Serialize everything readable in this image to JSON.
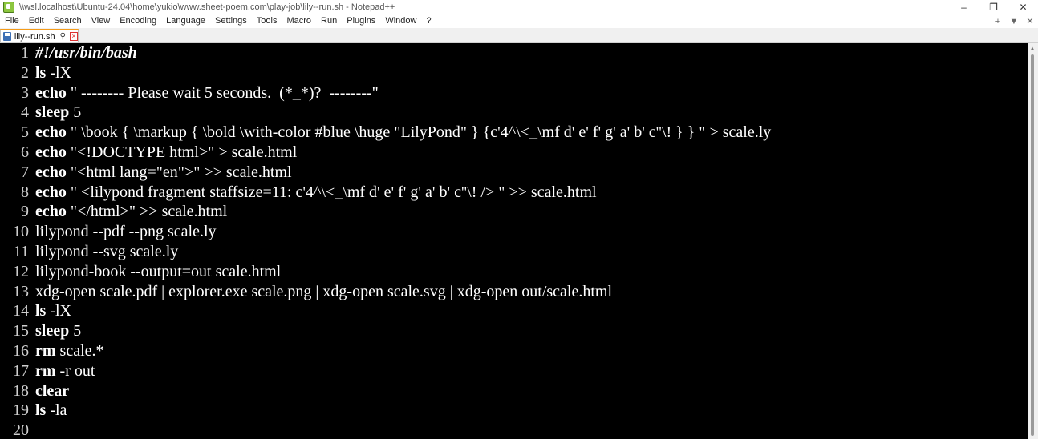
{
  "window": {
    "title": "\\\\wsl.localhost\\Ubuntu-24.04\\home\\yukio\\www.sheet-poem.com\\play-job\\lily--run.sh - Notepad++",
    "minimize": "–",
    "restore": "❐",
    "close": "✕"
  },
  "menu": {
    "items": [
      "File",
      "Edit",
      "Search",
      "View",
      "Encoding",
      "Language",
      "Settings",
      "Tools",
      "Macro",
      "Run",
      "Plugins",
      "Window",
      "?"
    ],
    "right": [
      "+",
      "▼",
      "✕"
    ]
  },
  "tab": {
    "label": "lily--run.sh",
    "pin": "📌",
    "close": "×"
  },
  "editor": {
    "lines": [
      {
        "n": "1",
        "kw": "#!/usr/bin/bash",
        "kwStyle": "shebang",
        "rest": ""
      },
      {
        "n": "2",
        "kw": "ls",
        "rest": " -lX"
      },
      {
        "n": "3",
        "kw": "echo",
        "rest": " \" -------- Please wait 5 seconds.  (*_*)?  --------\""
      },
      {
        "n": "4",
        "kw": "sleep",
        "rest": " 5"
      },
      {
        "n": "5",
        "kw": "echo",
        "rest": " \" \\book { \\markup { \\bold \\with-color #blue \\huge \"LilyPond\" } {c'4^\\<_\\mf d' e' f' g' a' b' c''\\! } } \" > scale.ly"
      },
      {
        "n": "6",
        "kw": "echo",
        "rest": " \"<!DOCTYPE html>\" > scale.html"
      },
      {
        "n": "7",
        "kw": "echo",
        "rest": " \"<html lang=\"en\">\" >> scale.html"
      },
      {
        "n": "8",
        "kw": "echo",
        "rest": " \" <lilypond fragment staffsize=11: c'4^\\<_\\mf d' e' f' g' a' b' c''\\! /> \" >> scale.html"
      },
      {
        "n": "9",
        "kw": "echo",
        "rest": " \"</html>\" >> scale.html"
      },
      {
        "n": "10",
        "kw": "",
        "rest": "lilypond --pdf --png scale.ly"
      },
      {
        "n": "11",
        "kw": "",
        "rest": "lilypond --svg scale.ly"
      },
      {
        "n": "12",
        "kw": "",
        "rest": "lilypond-book --output=out scale.html"
      },
      {
        "n": "13",
        "kw": "",
        "rest": "xdg-open scale.pdf | explorer.exe scale.png | xdg-open scale.svg | xdg-open out/scale.html"
      },
      {
        "n": "14",
        "kw": "ls",
        "rest": " -lX"
      },
      {
        "n": "15",
        "kw": "sleep",
        "rest": " 5"
      },
      {
        "n": "16",
        "kw": "rm",
        "rest": " scale.*"
      },
      {
        "n": "17",
        "kw": "rm",
        "rest": " -r out"
      },
      {
        "n": "18",
        "kw": "clear",
        "rest": ""
      },
      {
        "n": "19",
        "kw": "ls",
        "rest": " -la"
      },
      {
        "n": "20",
        "kw": "",
        "rest": ""
      }
    ]
  },
  "colors": {
    "editorBackground": "#000000",
    "editorText": "#ffffff",
    "tabAccent": "#f59c1a"
  }
}
